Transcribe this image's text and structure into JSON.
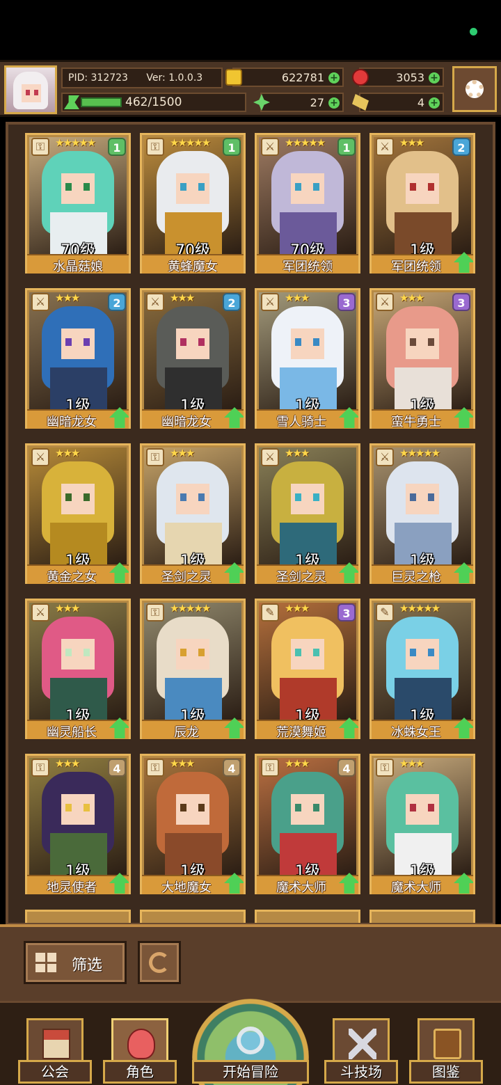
{
  "header": {
    "pid": "PID: 312723",
    "version": "Ver: 1.0.0.3",
    "xp_text": "462/1500",
    "xp_progress": 0.308,
    "gold": "622781",
    "gems": "3053",
    "clover": "27",
    "tickets": "4"
  },
  "cards": [
    {
      "name": "水晶菇娘",
      "level": "70级",
      "stars": "★★★★★",
      "tier": "1",
      "type": "key",
      "upgrade": false,
      "hair": "#5fd2b9",
      "outfit": "#e8eef0",
      "eyes": "#2a8a4a",
      "tier_color": "#5fbf66"
    },
    {
      "name": "黄蜂魔女",
      "level": "70级",
      "stars": "★★★★★",
      "tier": "1",
      "type": "key",
      "upgrade": false,
      "hair": "#e9ebee",
      "outfit": "#c9912e",
      "eyes": "#3aa0c4",
      "tier_color": "#5fbf66"
    },
    {
      "name": "军团统领",
      "level": "70级",
      "stars": "★★★★★",
      "tier": "1",
      "type": "sword",
      "upgrade": false,
      "hair": "#c0b8d8",
      "outfit": "#6b5a9a",
      "eyes": "#3aa0c4",
      "tier_color": "#5fbf66"
    },
    {
      "name": "军团统领",
      "level": "1级",
      "stars": "★★★",
      "tier": "2",
      "type": "sword",
      "upgrade": true,
      "hair": "#e2c08a",
      "outfit": "#7a4a2a",
      "eyes": "#b03030",
      "tier_color": "#4aa6d8"
    },
    {
      "name": "幽暗龙女",
      "level": "1级",
      "stars": "★★★",
      "tier": "2",
      "type": "sword",
      "upgrade": true,
      "hair": "#2f6fb8",
      "outfit": "#2b3f66",
      "eyes": "#6b3fb0",
      "tier_color": "#4aa6d8"
    },
    {
      "name": "幽暗龙女",
      "level": "1级",
      "stars": "★★★",
      "tier": "2",
      "type": "sword",
      "upgrade": true,
      "hair": "#5a5c58",
      "outfit": "#2f2f2f",
      "eyes": "#b03060",
      "tier_color": "#4aa6d8"
    },
    {
      "name": "雪人骑士",
      "level": "1级",
      "stars": "★★★",
      "tier": "3",
      "type": "sword",
      "upgrade": true,
      "hair": "#eef2f8",
      "outfit": "#7ab8e6",
      "eyes": "#3a8ac4",
      "tier_color": "#9a6ad0"
    },
    {
      "name": "蛮牛勇士",
      "level": "1级",
      "stars": "★★★",
      "tier": "3",
      "type": "sword",
      "upgrade": true,
      "hair": "#e89a8a",
      "outfit": "#e8e0d8",
      "eyes": "#6a4a3a",
      "tier_color": "#9a6ad0"
    },
    {
      "name": "黄金之女",
      "level": "1级",
      "stars": "★★★",
      "tier": "",
      "type": "sword",
      "upgrade": true,
      "hair": "#d8b23a",
      "outfit": "#b58a20",
      "eyes": "#3a6a2a",
      "tier_color": "#9a6ad0"
    },
    {
      "name": "圣剑之灵",
      "level": "1级",
      "stars": "★★★",
      "tier": "",
      "type": "key",
      "upgrade": true,
      "hair": "#dfe6ee",
      "outfit": "#e6d6b0",
      "eyes": "#4a7ab0",
      "tier_color": "#9a6ad0"
    },
    {
      "name": "圣剑之灵",
      "level": "1级",
      "stars": "★★★",
      "tier": "",
      "type": "sword",
      "upgrade": true,
      "hair": "#c8b040",
      "outfit": "#2e6a7a",
      "eyes": "#3ab0c4",
      "tier_color": "#9a6ad0"
    },
    {
      "name": "巨灵之枪",
      "level": "1级",
      "stars": "★★★★★",
      "tier": "",
      "type": "sword",
      "upgrade": true,
      "hair": "#dde4ee",
      "outfit": "#8aa0c0",
      "eyes": "#4a6a9a",
      "tier_color": "#9a6ad0"
    },
    {
      "name": "幽灵船长",
      "level": "1级",
      "stars": "★★★",
      "tier": "",
      "type": "sword",
      "upgrade": true,
      "hair": "#e05a86",
      "outfit": "#2f5a4a",
      "eyes": "#c0e8c0",
      "tier_color": "#9a6ad0"
    },
    {
      "name": "辰龙",
      "level": "1级",
      "stars": "★★★★★",
      "tier": "",
      "type": "key",
      "upgrade": true,
      "hair": "#e8dcc8",
      "outfit": "#4a8ac0",
      "eyes": "#d8a030",
      "tier_color": "#9a6ad0"
    },
    {
      "name": "荒漠舞姬",
      "level": "1级",
      "stars": "★★★",
      "tier": "3",
      "type": "wand",
      "upgrade": true,
      "hair": "#f0c060",
      "outfit": "#b03a2a",
      "eyes": "#4ac0b0",
      "tier_color": "#9a6ad0"
    },
    {
      "name": "冰蛛女王",
      "level": "1级",
      "stars": "★★★★★",
      "tier": "",
      "type": "wand",
      "upgrade": true,
      "hair": "#7ad0e6",
      "outfit": "#2a4a6a",
      "eyes": "#3a8ac4",
      "tier_color": "#9a6ad0"
    },
    {
      "name": "地灵使者",
      "level": "1级",
      "stars": "★★★",
      "tier": "4",
      "type": "key",
      "upgrade": true,
      "hair": "#3a2a5a",
      "outfit": "#4a6a3a",
      "eyes": "#e8c040",
      "tier_color": "#c0a070"
    },
    {
      "name": "大地魔女",
      "level": "1级",
      "stars": "★★★",
      "tier": "4",
      "type": "key",
      "upgrade": true,
      "hair": "#c06a3a",
      "outfit": "#8a4a2a",
      "eyes": "#5a3a1a",
      "tier_color": "#c0a070"
    },
    {
      "name": "魔术大师",
      "level": "1级",
      "stars": "★★★",
      "tier": "4",
      "type": "key",
      "upgrade": true,
      "hair": "#4aa08a",
      "outfit": "#c03a3a",
      "eyes": "#3a8a6a",
      "tier_color": "#c0a070"
    },
    {
      "name": "魔术大师",
      "level": "1级",
      "stars": "★★★",
      "tier": "",
      "type": "key",
      "upgrade": true,
      "hair": "#5ac0a0",
      "outfit": "#f0f0f0",
      "eyes": "#b03040",
      "tier_color": "#c0a070"
    }
  ],
  "peek_count": 4,
  "filter": {
    "label": "筛选"
  },
  "nav": {
    "guild": "公会",
    "role": "角色",
    "adventure": "开始冒险",
    "arena": "斗技场",
    "codex": "图鉴"
  },
  "colors": {
    "panel": "#3b2a1e",
    "card_border": "#e6b55c",
    "upgrade": "#4fd056"
  }
}
